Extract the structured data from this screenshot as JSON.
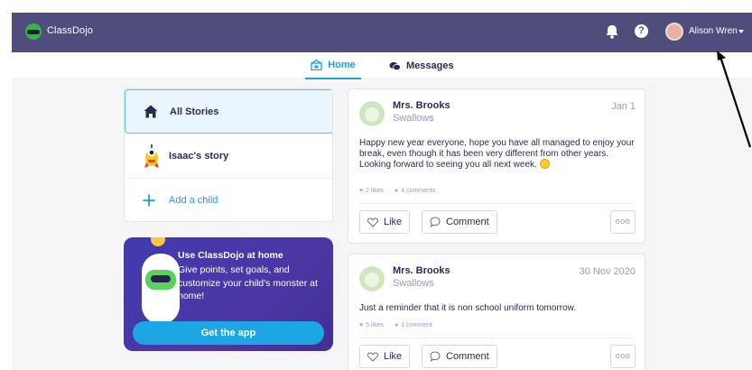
{
  "app": {
    "brand": "ClassDojo"
  },
  "header": {
    "user_name": "Alison Wren",
    "help_label": "?"
  },
  "tabs": [
    {
      "label": "Home",
      "active": true
    },
    {
      "label": "Messages",
      "active": false
    }
  ],
  "sidebar": {
    "items": [
      {
        "label": "All Stories",
        "icon": "home-icon",
        "selected": true
      },
      {
        "label": "Isaac's story",
        "icon": "monster-avatar-icon",
        "selected": false
      },
      {
        "label": "Add a child",
        "icon": "plus-icon",
        "selected": false
      }
    ]
  },
  "promo": {
    "title": "Use ClassDojo at home",
    "body": "Give points, set goals, and customize your child's monster at home!",
    "cta": "Get the app"
  },
  "posts": [
    {
      "author": "Mrs. Brooks",
      "class": "Swallows",
      "date": "Jan 1",
      "text": "Happy new year everyone, hope you have all managed to enjoy your break, even though it has been very different from other years. Looking forward to seeing you all next week.",
      "likes": "2 likes",
      "comments": "4 comments",
      "like_label": "Like",
      "comment_label": "Comment",
      "more_label": "ooo"
    },
    {
      "author": "Mrs. Brooks",
      "class": "Swallows",
      "date": "30 Nov 2020",
      "text": "Just a reminder that it is non school uniform tomorrow.",
      "likes": "5 likes",
      "comments": "1 comment",
      "like_label": "Like",
      "comment_label": "Comment",
      "more_label": "ooo"
    }
  ],
  "colors": {
    "topbar": "#4f4d7e",
    "accent": "#1a9fd9",
    "promo": "#4d36a4",
    "muted": "#9a99c4"
  }
}
